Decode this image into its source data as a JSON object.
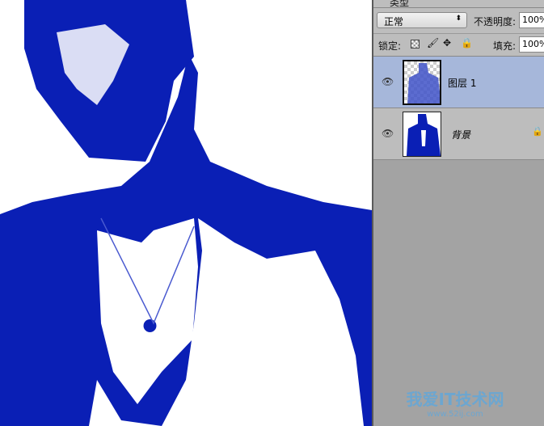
{
  "panel": {
    "filter_label": "类型",
    "blend_mode": "正常",
    "opacity_label": "不透明度:",
    "opacity_value": "100%",
    "lock_label": "锁定:",
    "fill_label": "填充:",
    "fill_value": "100%",
    "layers": [
      {
        "name": "图层 1",
        "selected": true,
        "visible": true,
        "locked": false
      },
      {
        "name": "背景",
        "selected": false,
        "visible": true,
        "locked": true
      }
    ]
  },
  "colors": {
    "image_blue": "#0a1fb5",
    "selection": "#a6b7da",
    "panel": "#bdbdbd"
  },
  "watermark": {
    "title": "我爱IT技术网",
    "url": "www.52ij.com"
  }
}
